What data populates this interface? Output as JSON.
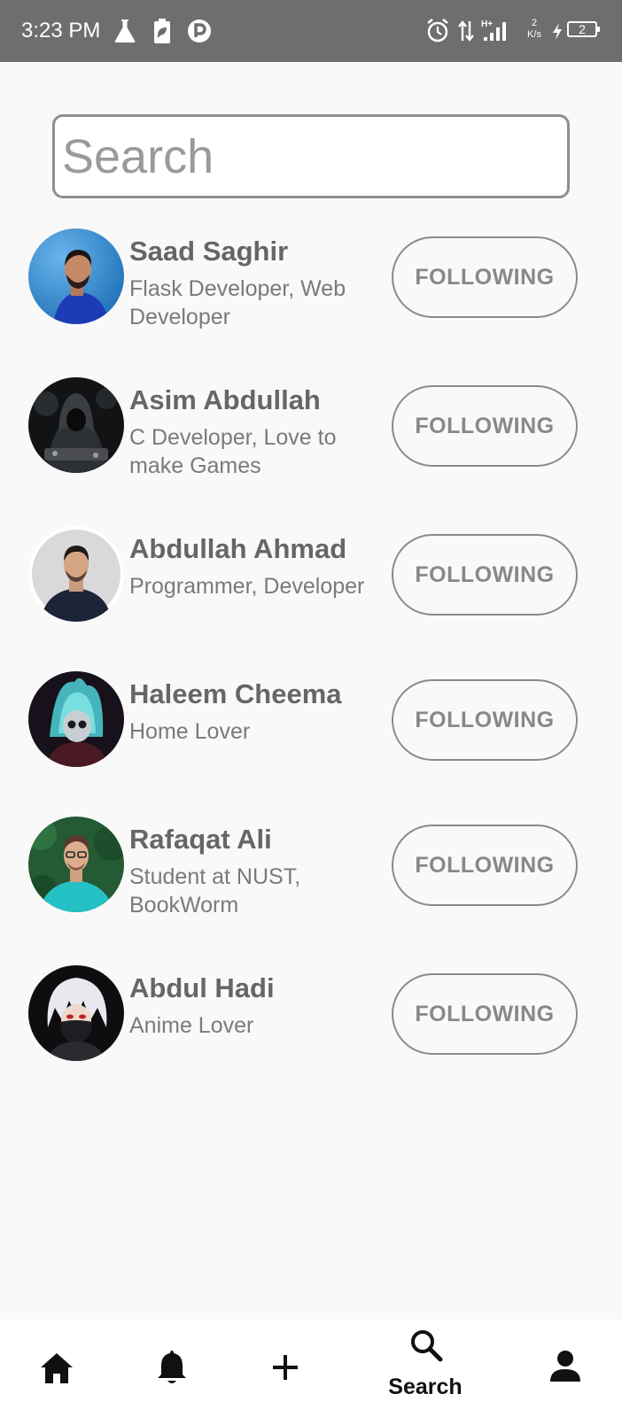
{
  "status_bar": {
    "time": "3:23 PM",
    "network_speed_value": "2",
    "network_speed_unit": "K/s",
    "battery_level": "2",
    "icons": [
      "flask-icon",
      "battery-saver-icon",
      "app-notification-icon",
      "alarm-icon",
      "data-arrows-icon",
      "signal-icon",
      "charging-icon"
    ]
  },
  "search": {
    "placeholder": "Search",
    "value": ""
  },
  "users": [
    {
      "name": "Saad Saghir",
      "bio": "Flask Developer, Web Developer",
      "button_label": "FOLLOWING"
    },
    {
      "name": "Asim Abdullah",
      "bio": "C Developer, Love  to make Games",
      "button_label": "FOLLOWING"
    },
    {
      "name": "Abdullah Ahmad",
      "bio": "Programmer, Developer",
      "button_label": "FOLLOWING"
    },
    {
      "name": "Haleem Cheema",
      "bio": "Home Lover",
      "button_label": "FOLLOWING"
    },
    {
      "name": "Rafaqat Ali",
      "bio": "Student at NUST, BookWorm",
      "button_label": "FOLLOWING"
    },
    {
      "name": "Abdul Hadi",
      "bio": "Anime Lover",
      "button_label": "FOLLOWING"
    }
  ],
  "bottom_nav": {
    "items": [
      {
        "icon": "home-icon",
        "label": ""
      },
      {
        "icon": "bell-icon",
        "label": ""
      },
      {
        "icon": "plus-icon",
        "label": ""
      },
      {
        "icon": "search-icon",
        "label": "Search",
        "active": true
      },
      {
        "icon": "person-icon",
        "label": ""
      }
    ]
  },
  "colors": {
    "status_bar_bg": "#6e6e6e",
    "page_bg": "#f9f9f9",
    "text_primary": "#666666",
    "text_secondary": "#7a7a7a",
    "button_border": "#8a8a8a",
    "nav_icon": "#111111"
  }
}
